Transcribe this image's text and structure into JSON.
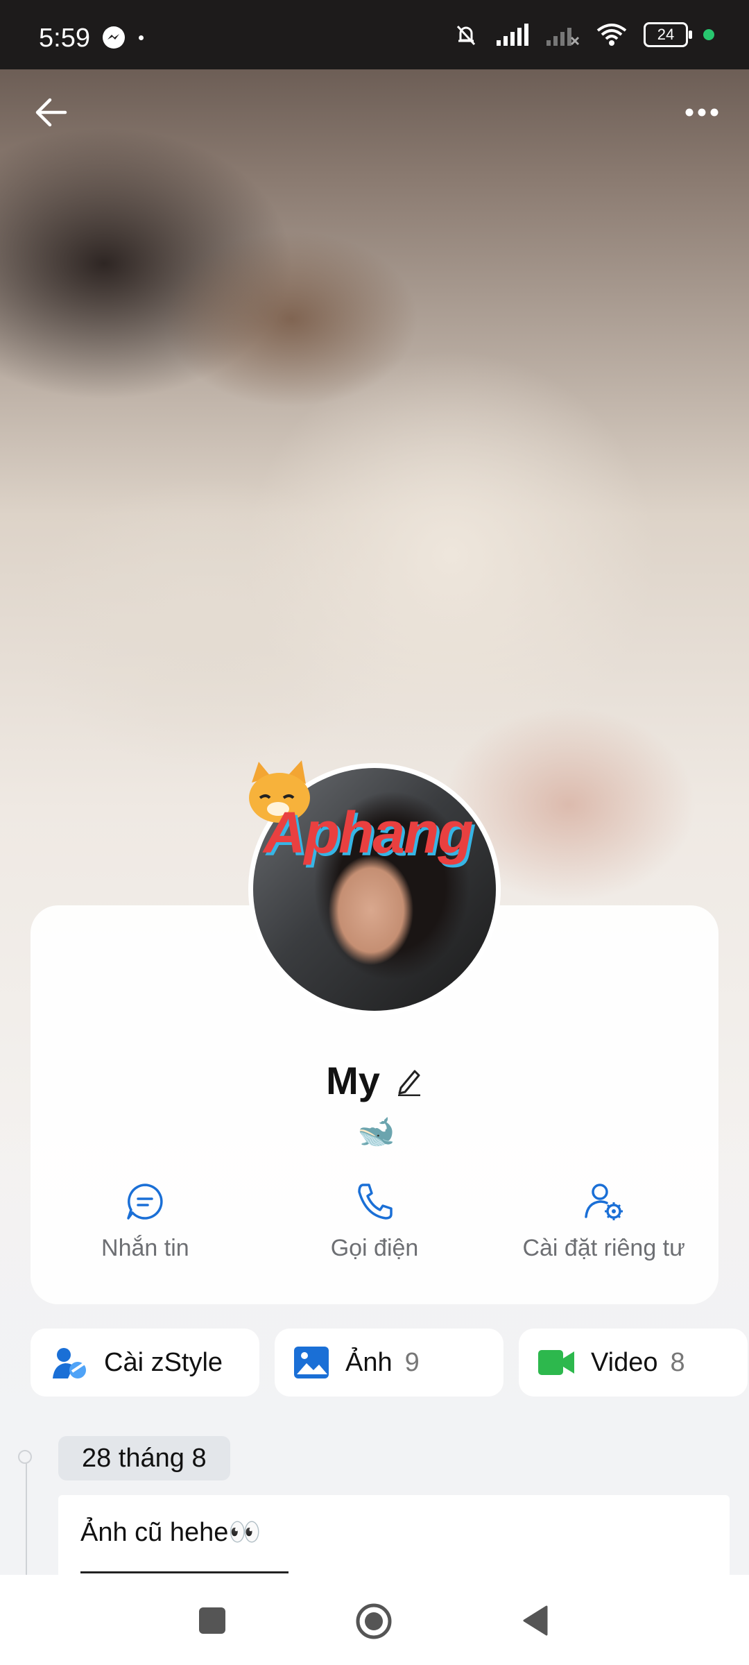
{
  "status_bar": {
    "time": "5:59",
    "battery": "24"
  },
  "profile": {
    "name": "My",
    "status_emoji": "🐋",
    "watermark": "Aphang"
  },
  "actions": [
    {
      "label": "Nhắn tin",
      "icon": "message-icon"
    },
    {
      "label": "Gọi điện",
      "icon": "phone-icon"
    },
    {
      "label": "Cài đặt riêng tư",
      "icon": "privacy-settings-icon"
    }
  ],
  "quick_tabs": [
    {
      "label": "Cài zStyle",
      "count": "",
      "icon": "zstyle-icon"
    },
    {
      "label": "Ảnh",
      "count": "9",
      "icon": "photo-icon"
    },
    {
      "label": "Video",
      "count": "8",
      "icon": "video-icon"
    }
  ],
  "timeline": {
    "date": "28 tháng 8",
    "post_text": "Ảnh cũ hehe👀"
  },
  "colors": {
    "accent": "#1a6fd6",
    "video_green": "#2db84d"
  }
}
